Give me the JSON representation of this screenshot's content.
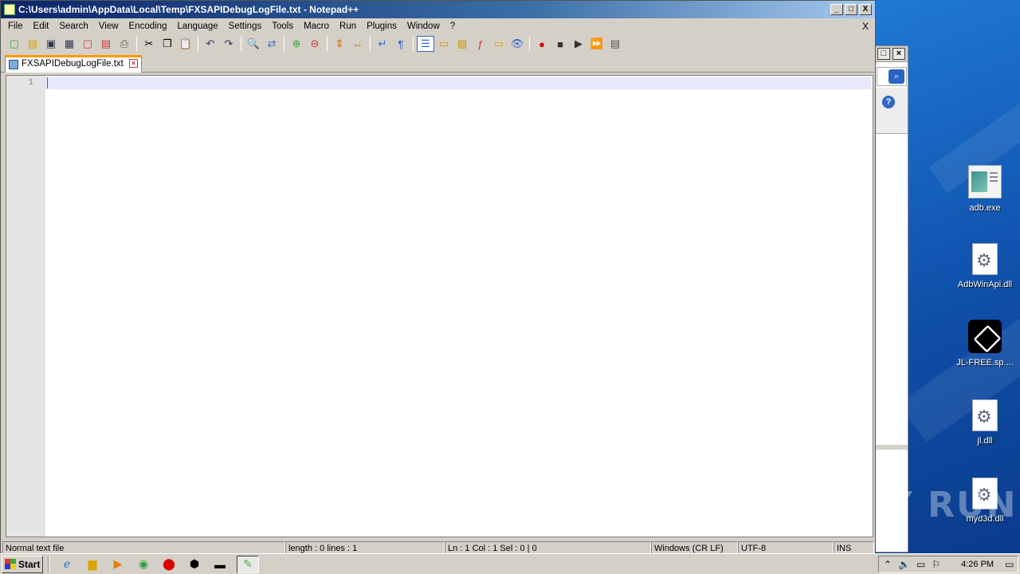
{
  "window": {
    "title": "C:\\Users\\admin\\AppData\\Local\\Temp\\FXSAPIDebugLogFile.txt - Notepad++",
    "controls": {
      "minimize": "_",
      "maximize": "□",
      "close": "X"
    }
  },
  "menu": {
    "items": [
      "File",
      "Edit",
      "Search",
      "View",
      "Encoding",
      "Language",
      "Settings",
      "Tools",
      "Macro",
      "Run",
      "Plugins",
      "Window",
      "?"
    ],
    "close_label": "X"
  },
  "tab": {
    "label": "FXSAPIDebugLogFile.txt",
    "close": "×"
  },
  "editor": {
    "line_number": "1",
    "content": ""
  },
  "status": {
    "filetype": "Normal text file",
    "length": "length : 0    lines : 1",
    "position": "Ln : 1    Col : 1    Sel : 0 | 0",
    "eol": "Windows (CR LF)",
    "encoding": "UTF-8",
    "mode": "INS"
  },
  "desktop_icons": [
    {
      "label": "adb.exe",
      "icon": "exe-icon"
    },
    {
      "label": "AdbWinApi.dll",
      "icon": "dll-icon"
    },
    {
      "label": "JL-FREE.sp....",
      "icon": "cube-icon"
    },
    {
      "label": "jl.dll",
      "icon": "dll-icon"
    },
    {
      "label": "myd3d.dll",
      "icon": "dll-icon"
    }
  ],
  "taskbar": {
    "start_label": "Start",
    "clock": "4:26 PM"
  },
  "watermark": "ANY RUN",
  "colors": {
    "titlebar": "#0a246a",
    "tab_accent": "#ff9900",
    "desktop": "#1e78d4"
  }
}
